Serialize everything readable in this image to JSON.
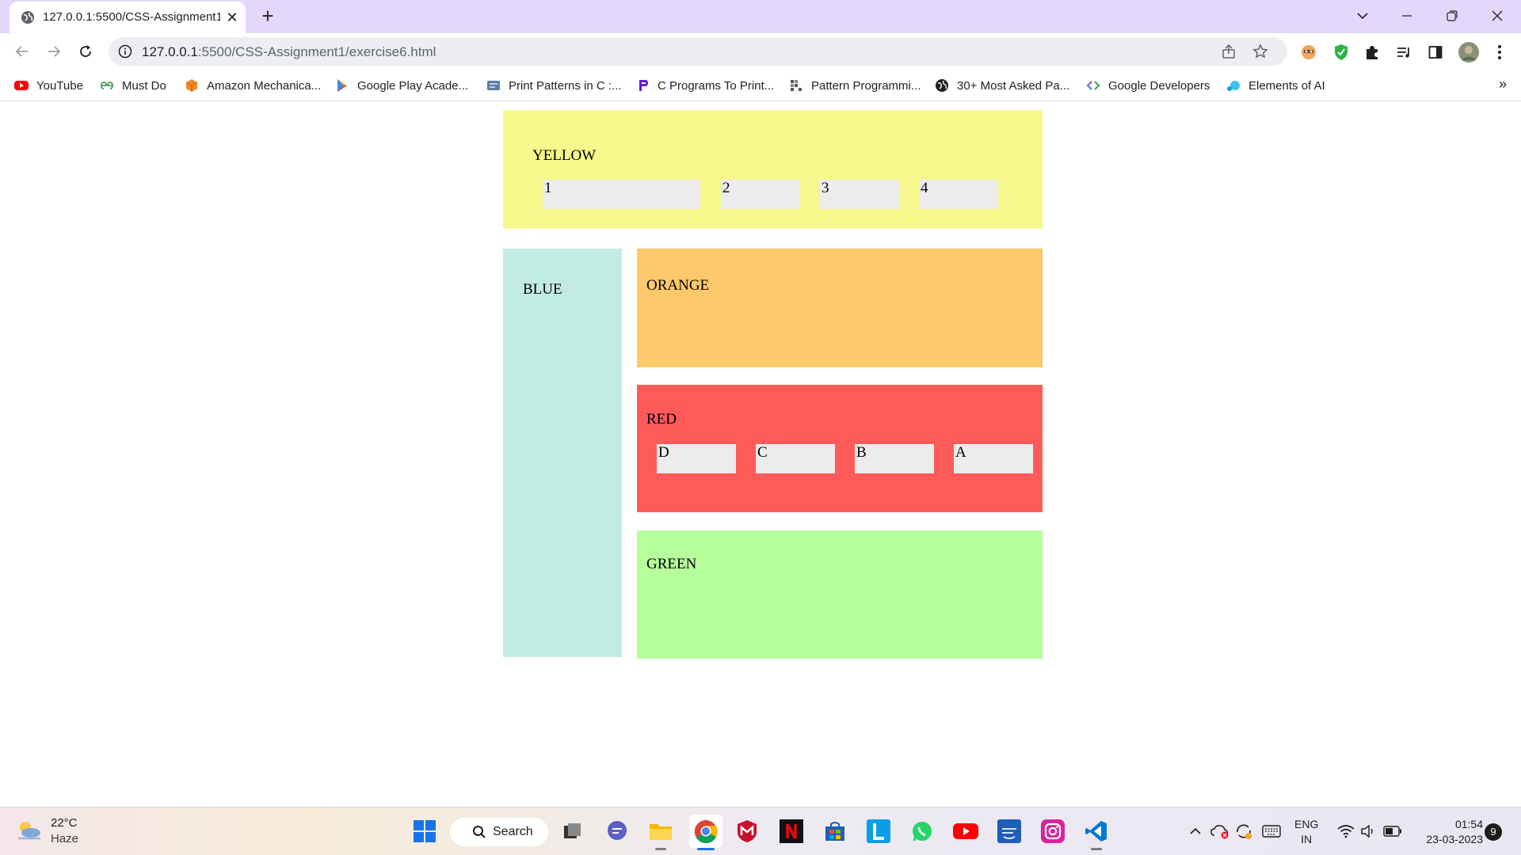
{
  "browser": {
    "tab_title": "127.0.0.1:5500/CSS-Assignment1/",
    "new_tab_symbol": "+",
    "close_symbol": "✕",
    "url_host": "127.0.0.1",
    "url_path": ":5500/CSS-Assignment1/exercise6.html"
  },
  "bookmarks": [
    {
      "label": "YouTube",
      "icon": "youtube-icon"
    },
    {
      "label": "Must Do",
      "icon": "gfg-icon"
    },
    {
      "label": "Amazon Mechanica...",
      "icon": "amazon-box-icon"
    },
    {
      "label": "Google Play Acade...",
      "icon": "google-play-icon"
    },
    {
      "label": "Print Patterns in C :...",
      "icon": "print-patterns-icon"
    },
    {
      "label": "C Programs To Print...",
      "icon": "c-programs-icon"
    },
    {
      "label": "Pattern Programmi...",
      "icon": "pattern-icon"
    },
    {
      "label": "30+ Most Asked Pa...",
      "icon": "globe-icon"
    },
    {
      "label": "Google Developers",
      "icon": "google-developers-icon"
    },
    {
      "label": "Elements of AI",
      "icon": "elements-of-ai-icon"
    }
  ],
  "bookmarks_more": "»",
  "page": {
    "yellow": {
      "label": "YELLOW",
      "items": [
        "1",
        "2",
        "3",
        "4"
      ]
    },
    "blue": {
      "label": "BLUE"
    },
    "orange": {
      "label": "ORANGE"
    },
    "red": {
      "label": "RED",
      "items": [
        "D",
        "C",
        "B",
        "A"
      ]
    },
    "green": {
      "label": "GREEN"
    }
  },
  "taskbar": {
    "weather_temp": "22°C",
    "weather_desc": "Haze",
    "search_label": "Search",
    "lang_line1": "ENG",
    "lang_line2": "IN",
    "time": "01:54",
    "date": "23-03-2023",
    "notification_count": "9"
  },
  "colors": {
    "yellow": "#f7f88b",
    "blue": "#c2ebe3",
    "orange": "#ffc86b",
    "red": "#ff5a5a",
    "green": "#b6ff9a",
    "cell": "#ececec"
  }
}
